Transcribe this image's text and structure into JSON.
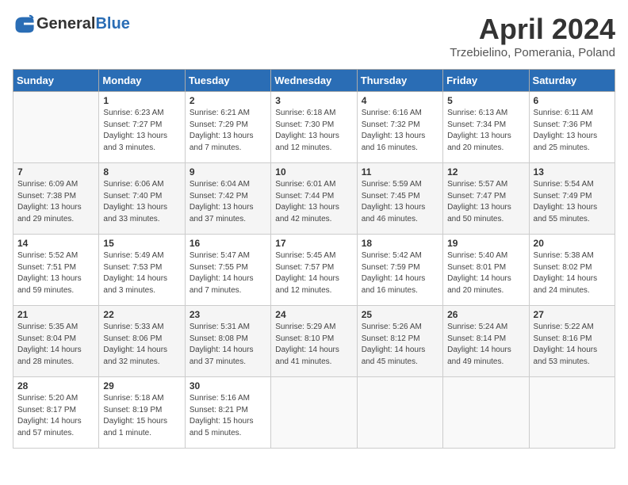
{
  "header": {
    "logo_general": "General",
    "logo_blue": "Blue",
    "month_title": "April 2024",
    "location": "Trzebielino, Pomerania, Poland"
  },
  "days_of_week": [
    "Sunday",
    "Monday",
    "Tuesday",
    "Wednesday",
    "Thursday",
    "Friday",
    "Saturday"
  ],
  "weeks": [
    [
      {
        "day": "",
        "sunrise": "",
        "sunset": "",
        "daylight": ""
      },
      {
        "day": "1",
        "sunrise": "Sunrise: 6:23 AM",
        "sunset": "Sunset: 7:27 PM",
        "daylight": "Daylight: 13 hours and 3 minutes."
      },
      {
        "day": "2",
        "sunrise": "Sunrise: 6:21 AM",
        "sunset": "Sunset: 7:29 PM",
        "daylight": "Daylight: 13 hours and 7 minutes."
      },
      {
        "day": "3",
        "sunrise": "Sunrise: 6:18 AM",
        "sunset": "Sunset: 7:30 PM",
        "daylight": "Daylight: 13 hours and 12 minutes."
      },
      {
        "day": "4",
        "sunrise": "Sunrise: 6:16 AM",
        "sunset": "Sunset: 7:32 PM",
        "daylight": "Daylight: 13 hours and 16 minutes."
      },
      {
        "day": "5",
        "sunrise": "Sunrise: 6:13 AM",
        "sunset": "Sunset: 7:34 PM",
        "daylight": "Daylight: 13 hours and 20 minutes."
      },
      {
        "day": "6",
        "sunrise": "Sunrise: 6:11 AM",
        "sunset": "Sunset: 7:36 PM",
        "daylight": "Daylight: 13 hours and 25 minutes."
      }
    ],
    [
      {
        "day": "7",
        "sunrise": "Sunrise: 6:09 AM",
        "sunset": "Sunset: 7:38 PM",
        "daylight": "Daylight: 13 hours and 29 minutes."
      },
      {
        "day": "8",
        "sunrise": "Sunrise: 6:06 AM",
        "sunset": "Sunset: 7:40 PM",
        "daylight": "Daylight: 13 hours and 33 minutes."
      },
      {
        "day": "9",
        "sunrise": "Sunrise: 6:04 AM",
        "sunset": "Sunset: 7:42 PM",
        "daylight": "Daylight: 13 hours and 37 minutes."
      },
      {
        "day": "10",
        "sunrise": "Sunrise: 6:01 AM",
        "sunset": "Sunset: 7:44 PM",
        "daylight": "Daylight: 13 hours and 42 minutes."
      },
      {
        "day": "11",
        "sunrise": "Sunrise: 5:59 AM",
        "sunset": "Sunset: 7:45 PM",
        "daylight": "Daylight: 13 hours and 46 minutes."
      },
      {
        "day": "12",
        "sunrise": "Sunrise: 5:57 AM",
        "sunset": "Sunset: 7:47 PM",
        "daylight": "Daylight: 13 hours and 50 minutes."
      },
      {
        "day": "13",
        "sunrise": "Sunrise: 5:54 AM",
        "sunset": "Sunset: 7:49 PM",
        "daylight": "Daylight: 13 hours and 55 minutes."
      }
    ],
    [
      {
        "day": "14",
        "sunrise": "Sunrise: 5:52 AM",
        "sunset": "Sunset: 7:51 PM",
        "daylight": "Daylight: 13 hours and 59 minutes."
      },
      {
        "day": "15",
        "sunrise": "Sunrise: 5:49 AM",
        "sunset": "Sunset: 7:53 PM",
        "daylight": "Daylight: 14 hours and 3 minutes."
      },
      {
        "day": "16",
        "sunrise": "Sunrise: 5:47 AM",
        "sunset": "Sunset: 7:55 PM",
        "daylight": "Daylight: 14 hours and 7 minutes."
      },
      {
        "day": "17",
        "sunrise": "Sunrise: 5:45 AM",
        "sunset": "Sunset: 7:57 PM",
        "daylight": "Daylight: 14 hours and 12 minutes."
      },
      {
        "day": "18",
        "sunrise": "Sunrise: 5:42 AM",
        "sunset": "Sunset: 7:59 PM",
        "daylight": "Daylight: 14 hours and 16 minutes."
      },
      {
        "day": "19",
        "sunrise": "Sunrise: 5:40 AM",
        "sunset": "Sunset: 8:01 PM",
        "daylight": "Daylight: 14 hours and 20 minutes."
      },
      {
        "day": "20",
        "sunrise": "Sunrise: 5:38 AM",
        "sunset": "Sunset: 8:02 PM",
        "daylight": "Daylight: 14 hours and 24 minutes."
      }
    ],
    [
      {
        "day": "21",
        "sunrise": "Sunrise: 5:35 AM",
        "sunset": "Sunset: 8:04 PM",
        "daylight": "Daylight: 14 hours and 28 minutes."
      },
      {
        "day": "22",
        "sunrise": "Sunrise: 5:33 AM",
        "sunset": "Sunset: 8:06 PM",
        "daylight": "Daylight: 14 hours and 32 minutes."
      },
      {
        "day": "23",
        "sunrise": "Sunrise: 5:31 AM",
        "sunset": "Sunset: 8:08 PM",
        "daylight": "Daylight: 14 hours and 37 minutes."
      },
      {
        "day": "24",
        "sunrise": "Sunrise: 5:29 AM",
        "sunset": "Sunset: 8:10 PM",
        "daylight": "Daylight: 14 hours and 41 minutes."
      },
      {
        "day": "25",
        "sunrise": "Sunrise: 5:26 AM",
        "sunset": "Sunset: 8:12 PM",
        "daylight": "Daylight: 14 hours and 45 minutes."
      },
      {
        "day": "26",
        "sunrise": "Sunrise: 5:24 AM",
        "sunset": "Sunset: 8:14 PM",
        "daylight": "Daylight: 14 hours and 49 minutes."
      },
      {
        "day": "27",
        "sunrise": "Sunrise: 5:22 AM",
        "sunset": "Sunset: 8:16 PM",
        "daylight": "Daylight: 14 hours and 53 minutes."
      }
    ],
    [
      {
        "day": "28",
        "sunrise": "Sunrise: 5:20 AM",
        "sunset": "Sunset: 8:17 PM",
        "daylight": "Daylight: 14 hours and 57 minutes."
      },
      {
        "day": "29",
        "sunrise": "Sunrise: 5:18 AM",
        "sunset": "Sunset: 8:19 PM",
        "daylight": "Daylight: 15 hours and 1 minute."
      },
      {
        "day": "30",
        "sunrise": "Sunrise: 5:16 AM",
        "sunset": "Sunset: 8:21 PM",
        "daylight": "Daylight: 15 hours and 5 minutes."
      },
      {
        "day": "",
        "sunrise": "",
        "sunset": "",
        "daylight": ""
      },
      {
        "day": "",
        "sunrise": "",
        "sunset": "",
        "daylight": ""
      },
      {
        "day": "",
        "sunrise": "",
        "sunset": "",
        "daylight": ""
      },
      {
        "day": "",
        "sunrise": "",
        "sunset": "",
        "daylight": ""
      }
    ]
  ]
}
